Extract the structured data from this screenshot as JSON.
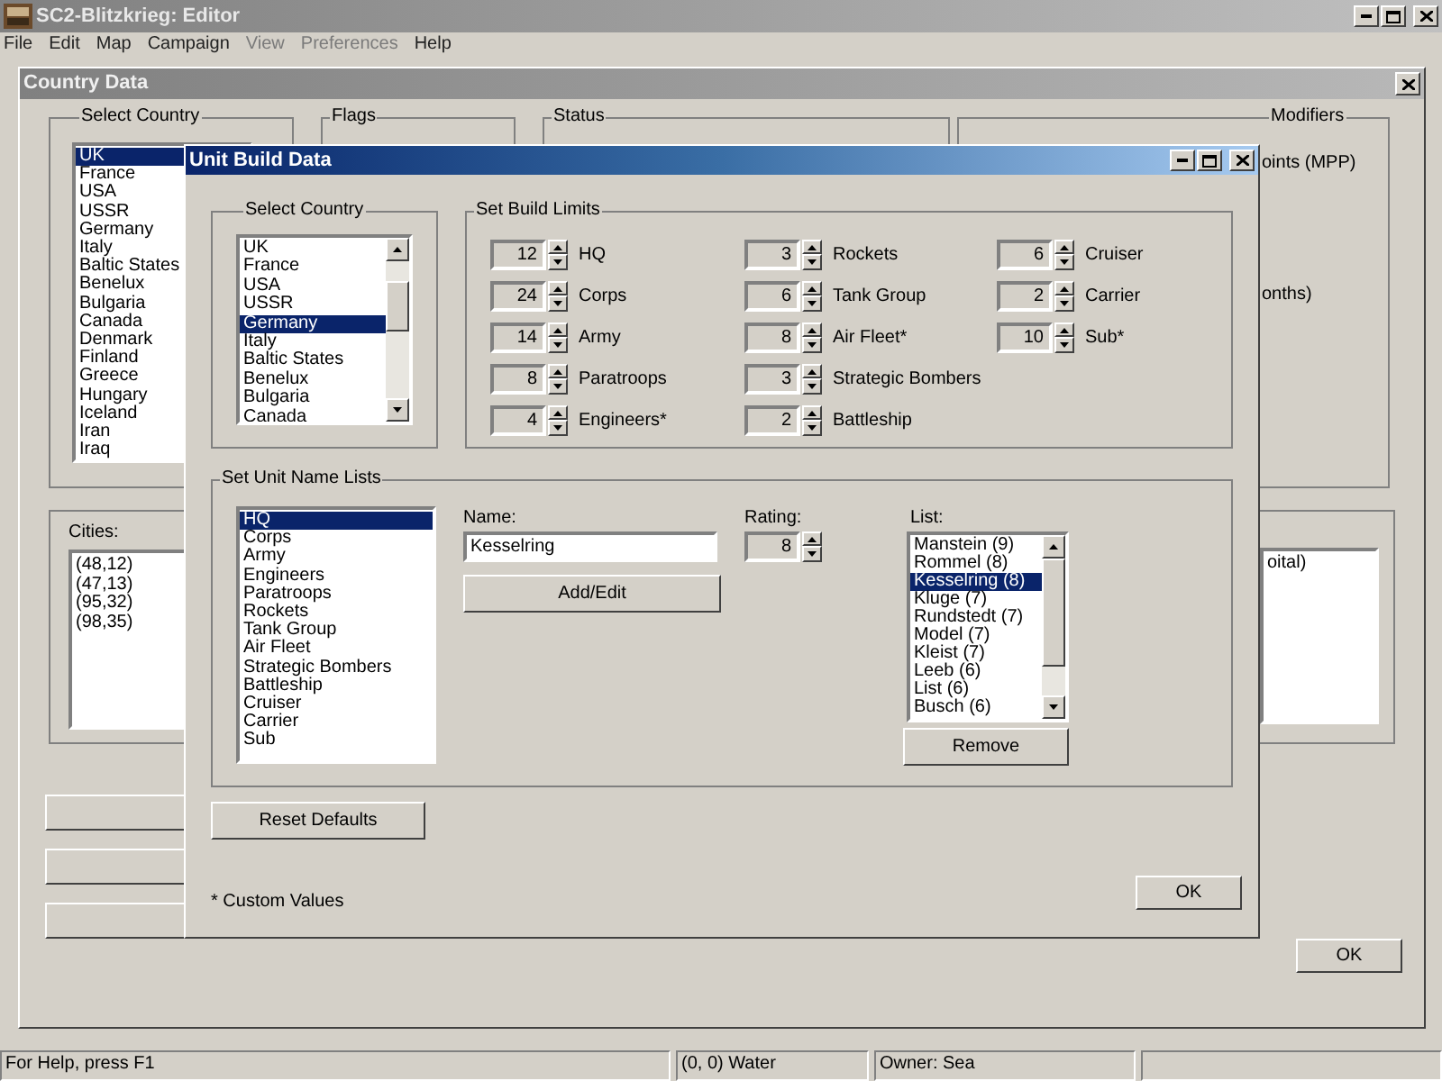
{
  "app": {
    "title": "SC2-Blitzkrieg: Editor",
    "menu": [
      {
        "label": "File",
        "disabled": false
      },
      {
        "label": "Edit",
        "disabled": false
      },
      {
        "label": "Map",
        "disabled": false
      },
      {
        "label": "Campaign",
        "disabled": false
      },
      {
        "label": "View",
        "disabled": true
      },
      {
        "label": "Preferences",
        "disabled": true
      },
      {
        "label": "Help",
        "disabled": false
      }
    ]
  },
  "country_data": {
    "title": "Country Data",
    "select_country": {
      "label": "Select Country",
      "countries": [
        {
          "name": "UK",
          "selected": true
        },
        {
          "name": "France",
          "selected": false
        },
        {
          "name": "USA",
          "selected": false
        },
        {
          "name": "USSR",
          "selected": false
        },
        {
          "name": "Germany",
          "selected": false
        },
        {
          "name": "Italy",
          "selected": false
        },
        {
          "name": "Baltic States",
          "selected": false
        },
        {
          "name": "Benelux",
          "selected": false
        },
        {
          "name": "Bulgaria",
          "selected": false
        },
        {
          "name": "Canada",
          "selected": false
        },
        {
          "name": "Denmark",
          "selected": false
        },
        {
          "name": "Finland",
          "selected": false
        },
        {
          "name": "Greece",
          "selected": false
        },
        {
          "name": "Hungary",
          "selected": false
        },
        {
          "name": "Iceland",
          "selected": false
        },
        {
          "name": "Iran",
          "selected": false
        },
        {
          "name": "Iraq",
          "selected": false
        }
      ]
    },
    "flags": {
      "label": "Flags"
    },
    "status": {
      "label": "Status"
    },
    "modifiers": {
      "label": "Modifiers",
      "texts": [
        "oints (MPP)",
        "onths)"
      ]
    },
    "cities": {
      "label": "Cities:",
      "items": [
        "(48,12)",
        "(47,13)",
        "(95,32)",
        "(98,35)"
      ]
    },
    "capital_list": [
      "oital)"
    ],
    "ok": "OK"
  },
  "unit_build_data": {
    "title": "Unit Build Data",
    "select_country": {
      "label": "Select Country",
      "countries": [
        {
          "name": "UK",
          "selected": false
        },
        {
          "name": "France",
          "selected": false
        },
        {
          "name": "USA",
          "selected": false
        },
        {
          "name": "USSR",
          "selected": false
        },
        {
          "name": "Germany",
          "selected": true
        },
        {
          "name": "Italy",
          "selected": false
        },
        {
          "name": "Baltic States",
          "selected": false
        },
        {
          "name": "Benelux",
          "selected": false
        },
        {
          "name": "Bulgaria",
          "selected": false
        },
        {
          "name": "Canada",
          "selected": false
        }
      ]
    },
    "build_limits": {
      "label": "Set Build Limits",
      "units": [
        {
          "value": "12",
          "label": "HQ"
        },
        {
          "value": "24",
          "label": "Corps"
        },
        {
          "value": "14",
          "label": "Army"
        },
        {
          "value": "8",
          "label": "Paratroops"
        },
        {
          "value": "4",
          "label": "Engineers*"
        },
        {
          "value": "3",
          "label": "Rockets"
        },
        {
          "value": "6",
          "label": "Tank Group"
        },
        {
          "value": "8",
          "label": "Air Fleet*"
        },
        {
          "value": "3",
          "label": "Strategic Bombers"
        },
        {
          "value": "2",
          "label": "Battleship"
        },
        {
          "value": "6",
          "label": "Cruiser"
        },
        {
          "value": "2",
          "label": "Carrier"
        },
        {
          "value": "10",
          "label": "Sub*"
        }
      ]
    },
    "name_lists": {
      "label": "Set Unit Name Lists",
      "unit_types": [
        {
          "name": "HQ",
          "selected": true
        },
        {
          "name": "Corps",
          "selected": false
        },
        {
          "name": "Army",
          "selected": false
        },
        {
          "name": "Engineers",
          "selected": false
        },
        {
          "name": "Paratroops",
          "selected": false
        },
        {
          "name": "Rockets",
          "selected": false
        },
        {
          "name": "Tank Group",
          "selected": false
        },
        {
          "name": "Air Fleet",
          "selected": false
        },
        {
          "name": "Strategic Bombers",
          "selected": false
        },
        {
          "name": "Battleship",
          "selected": false
        },
        {
          "name": "Cruiser",
          "selected": false
        },
        {
          "name": "Carrier",
          "selected": false
        },
        {
          "name": "Sub",
          "selected": false
        }
      ],
      "name_label": "Name:",
      "name_value": "Kesselring",
      "add_edit": "Add/Edit",
      "rating_label": "Rating:",
      "rating_value": "8",
      "list_label": "List:",
      "list": [
        {
          "name": "Manstein (9)",
          "selected": false
        },
        {
          "name": "Rommel (8)",
          "selected": false
        },
        {
          "name": "Kesselring (8)",
          "selected": true
        },
        {
          "name": "Kluge (7)",
          "selected": false
        },
        {
          "name": "Rundstedt (7)",
          "selected": false
        },
        {
          "name": "Model (7)",
          "selected": false
        },
        {
          "name": "Kleist (7)",
          "selected": false
        },
        {
          "name": "Leeb (6)",
          "selected": false
        },
        {
          "name": "List (6)",
          "selected": false
        },
        {
          "name": "Busch (6)",
          "selected": false
        }
      ],
      "remove": "Remove"
    },
    "reset_defaults": "Reset Defaults",
    "footnote": "* Custom Values",
    "ok": "OK"
  },
  "status_bar": [
    "For Help, press F1",
    "(0, 0) Water",
    "Owner:  Sea"
  ]
}
